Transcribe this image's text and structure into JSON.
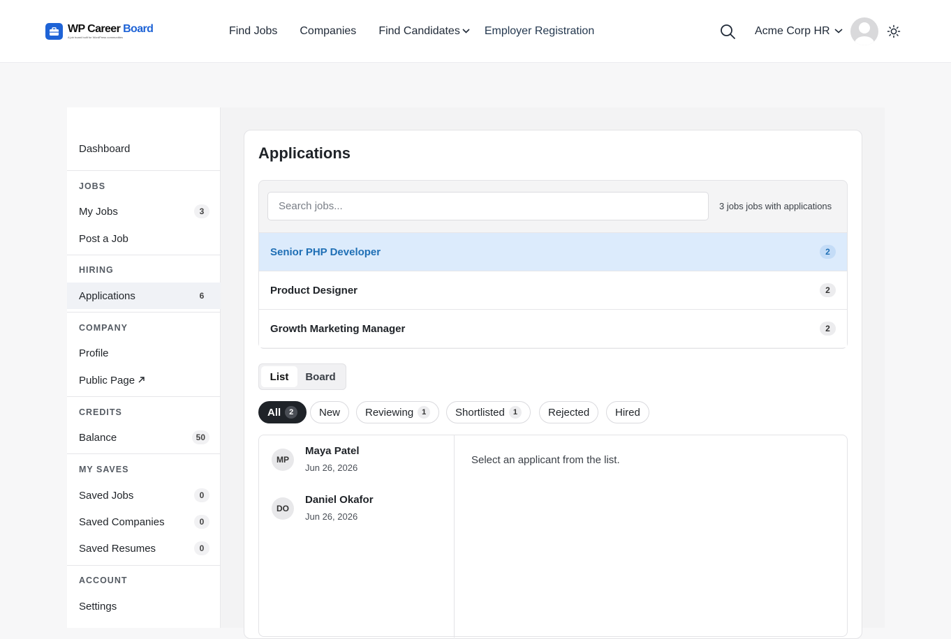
{
  "header": {
    "logo": {
      "name_part1": "WP Career",
      "name_part2": "Board",
      "tagline": "A job board built for WordPress communities"
    },
    "nav": [
      {
        "label": "Find Jobs"
      },
      {
        "label": "Companies"
      },
      {
        "label": "Find Candidates"
      },
      {
        "label": "Employer Registration"
      }
    ],
    "user": {
      "name": "Acme Corp HR"
    },
    "icons": [
      "search-icon",
      "chevron-down-icon",
      "avatar",
      "sun-icon"
    ]
  },
  "sidebar": {
    "dashboard": "Dashboard",
    "sections": {
      "jobs": "JOBS",
      "hiring": "HIRING",
      "company": "COMPANY",
      "credits": "CREDITS",
      "my_saves": "MY SAVES",
      "account": "ACCOUNT"
    },
    "items": {
      "my_jobs": {
        "label": "My Jobs",
        "count": "3"
      },
      "post_job": {
        "label": "Post a Job"
      },
      "applications": {
        "label": "Applications",
        "count": "6"
      },
      "profile": {
        "label": "Profile"
      },
      "public_page": {
        "label": "Public Page"
      },
      "balance": {
        "label": "Balance",
        "count": "50"
      },
      "saved_jobs": {
        "label": "Saved Jobs",
        "count": "0"
      },
      "saved_companies": {
        "label": "Saved Companies",
        "count": "0"
      },
      "saved_resumes": {
        "label": "Saved Resumes",
        "count": "0"
      },
      "settings": {
        "label": "Settings"
      }
    }
  },
  "main": {
    "title": "Applications",
    "search": {
      "placeholder": "Search jobs...",
      "value": ""
    },
    "jobs_summary": "3 jobs jobs with applications",
    "jobs": [
      {
        "title": "Senior PHP Developer",
        "count": "2",
        "selected": true
      },
      {
        "title": "Product Designer",
        "count": "2",
        "selected": false
      },
      {
        "title": "Growth Marketing Manager",
        "count": "2",
        "selected": false
      }
    ],
    "view_toggle": {
      "list": "List",
      "board": "Board",
      "active": "List"
    },
    "filters": [
      {
        "label": "All",
        "count": "2",
        "active": true
      },
      {
        "label": "New"
      },
      {
        "label": "Reviewing",
        "count": "1"
      },
      {
        "label": "Shortlisted",
        "count": "1"
      },
      {
        "label": "Rejected"
      },
      {
        "label": "Hired"
      }
    ],
    "applicants": [
      {
        "initials": "MP",
        "name": "Maya Patel",
        "date": "Jun 26, 2026"
      },
      {
        "initials": "DO",
        "name": "Daniel Okafor",
        "date": "Jun 26, 2026"
      }
    ],
    "detail_empty": "Select an applicant from the list."
  },
  "colors": {
    "brand": "#1e63d6",
    "selected_row_bg": "#dcebfc",
    "selected_row_text": "#1f6fb5",
    "active_chip_bg": "#1f2328"
  }
}
